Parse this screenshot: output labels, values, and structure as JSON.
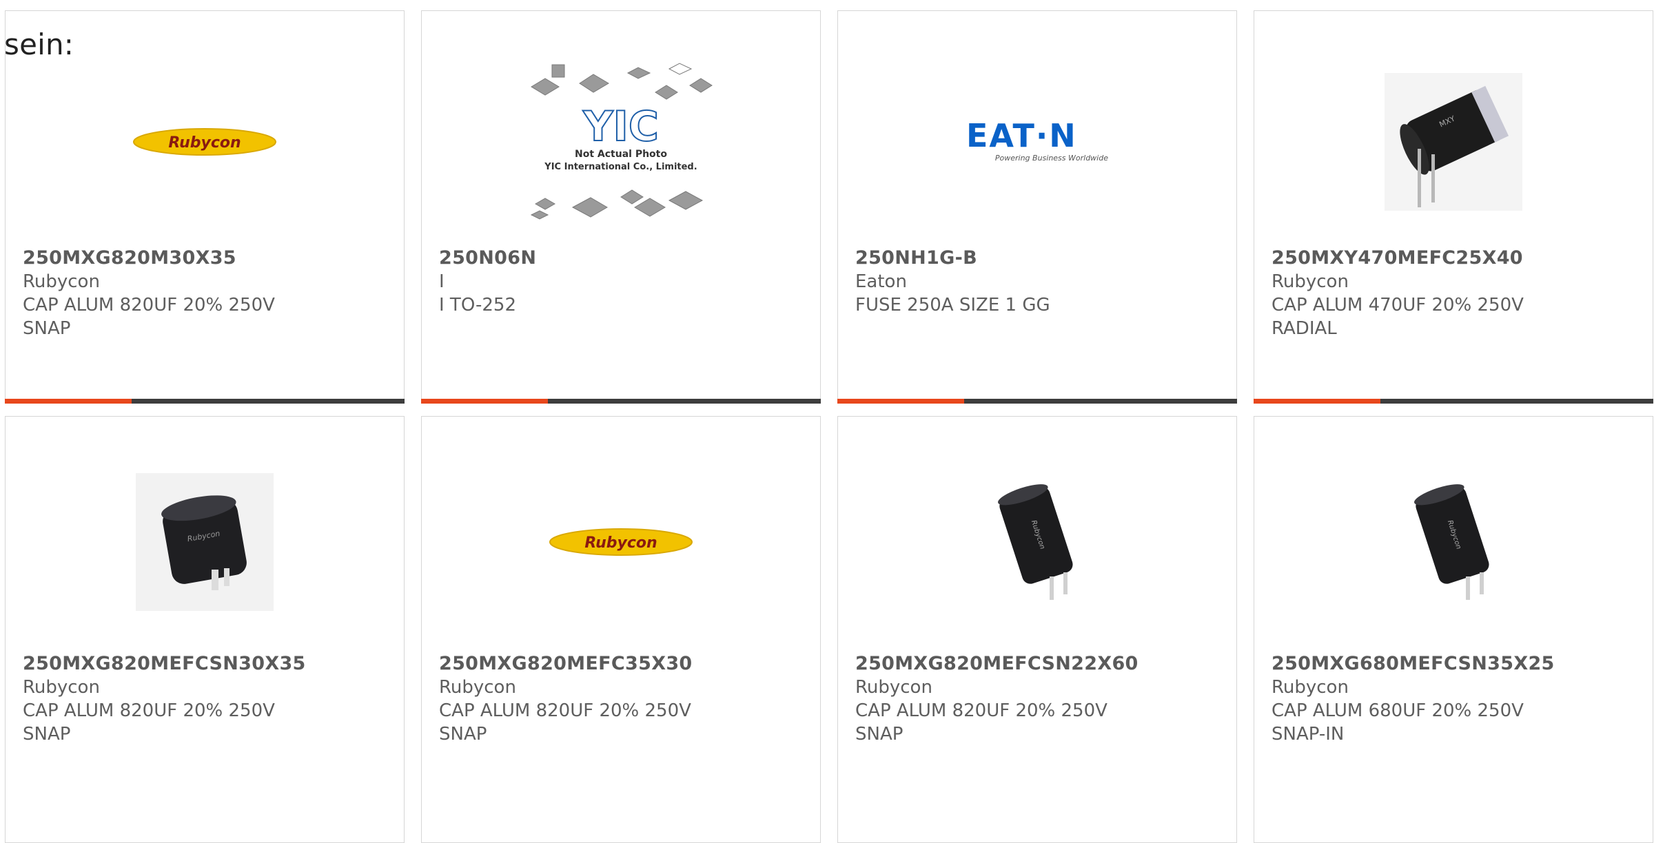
{
  "intro_text": "sein:",
  "colors": {
    "accent": "#e8471c",
    "bar_dark": "#3d3d3d",
    "border": "#d6d6d6",
    "text": "#5a5a5a"
  },
  "products": [
    {
      "part": "250MXG820M30X35",
      "brand": "Rubycon",
      "desc1": "CAP ALUM 820UF 20% 250V",
      "desc2": "SNAP",
      "image": "rubycon-logo",
      "logo_text": "Rubycon"
    },
    {
      "part": "250N06N",
      "brand": "I",
      "desc1": "I TO-252",
      "desc2": "",
      "image": "yic-not-actual-photo",
      "logo_text": "YIC",
      "photo_caption1": "Not Actual Photo",
      "photo_caption2": "YIC International Co., Limited."
    },
    {
      "part": "250NH1G-B",
      "brand": "Eaton",
      "desc1": "FUSE 250A SIZE 1 GG",
      "desc2": "",
      "image": "eaton-logo",
      "logo_text": "EAT·N",
      "logo_tagline": "Powering Business Worldwide"
    },
    {
      "part": "250MXY470MEFC25X40",
      "brand": "Rubycon",
      "desc1": "CAP ALUM 470UF 20% 250V",
      "desc2": "RADIAL",
      "image": "capacitor-radial-photo"
    },
    {
      "part": "250MXG820MEFCSN30X35",
      "brand": "Rubycon",
      "desc1": "CAP ALUM 820UF 20% 250V",
      "desc2": "SNAP",
      "image": "capacitor-snap-short-photo"
    },
    {
      "part": "250MXG820MEFC35X30",
      "brand": "Rubycon",
      "desc1": "CAP ALUM 820UF 20% 250V",
      "desc2": "SNAP",
      "image": "rubycon-logo",
      "logo_text": "Rubycon"
    },
    {
      "part": "250MXG820MEFCSN22X60",
      "brand": "Rubycon",
      "desc1": "CAP ALUM 820UF 20% 250V",
      "desc2": "SNAP",
      "image": "capacitor-snap-tall-photo"
    },
    {
      "part": "250MXG680MEFCSN35X25",
      "brand": "Rubycon",
      "desc1": "CAP ALUM 680UF 20% 250V",
      "desc2": "SNAP-IN",
      "image": "capacitor-snap-tall-photo"
    }
  ]
}
